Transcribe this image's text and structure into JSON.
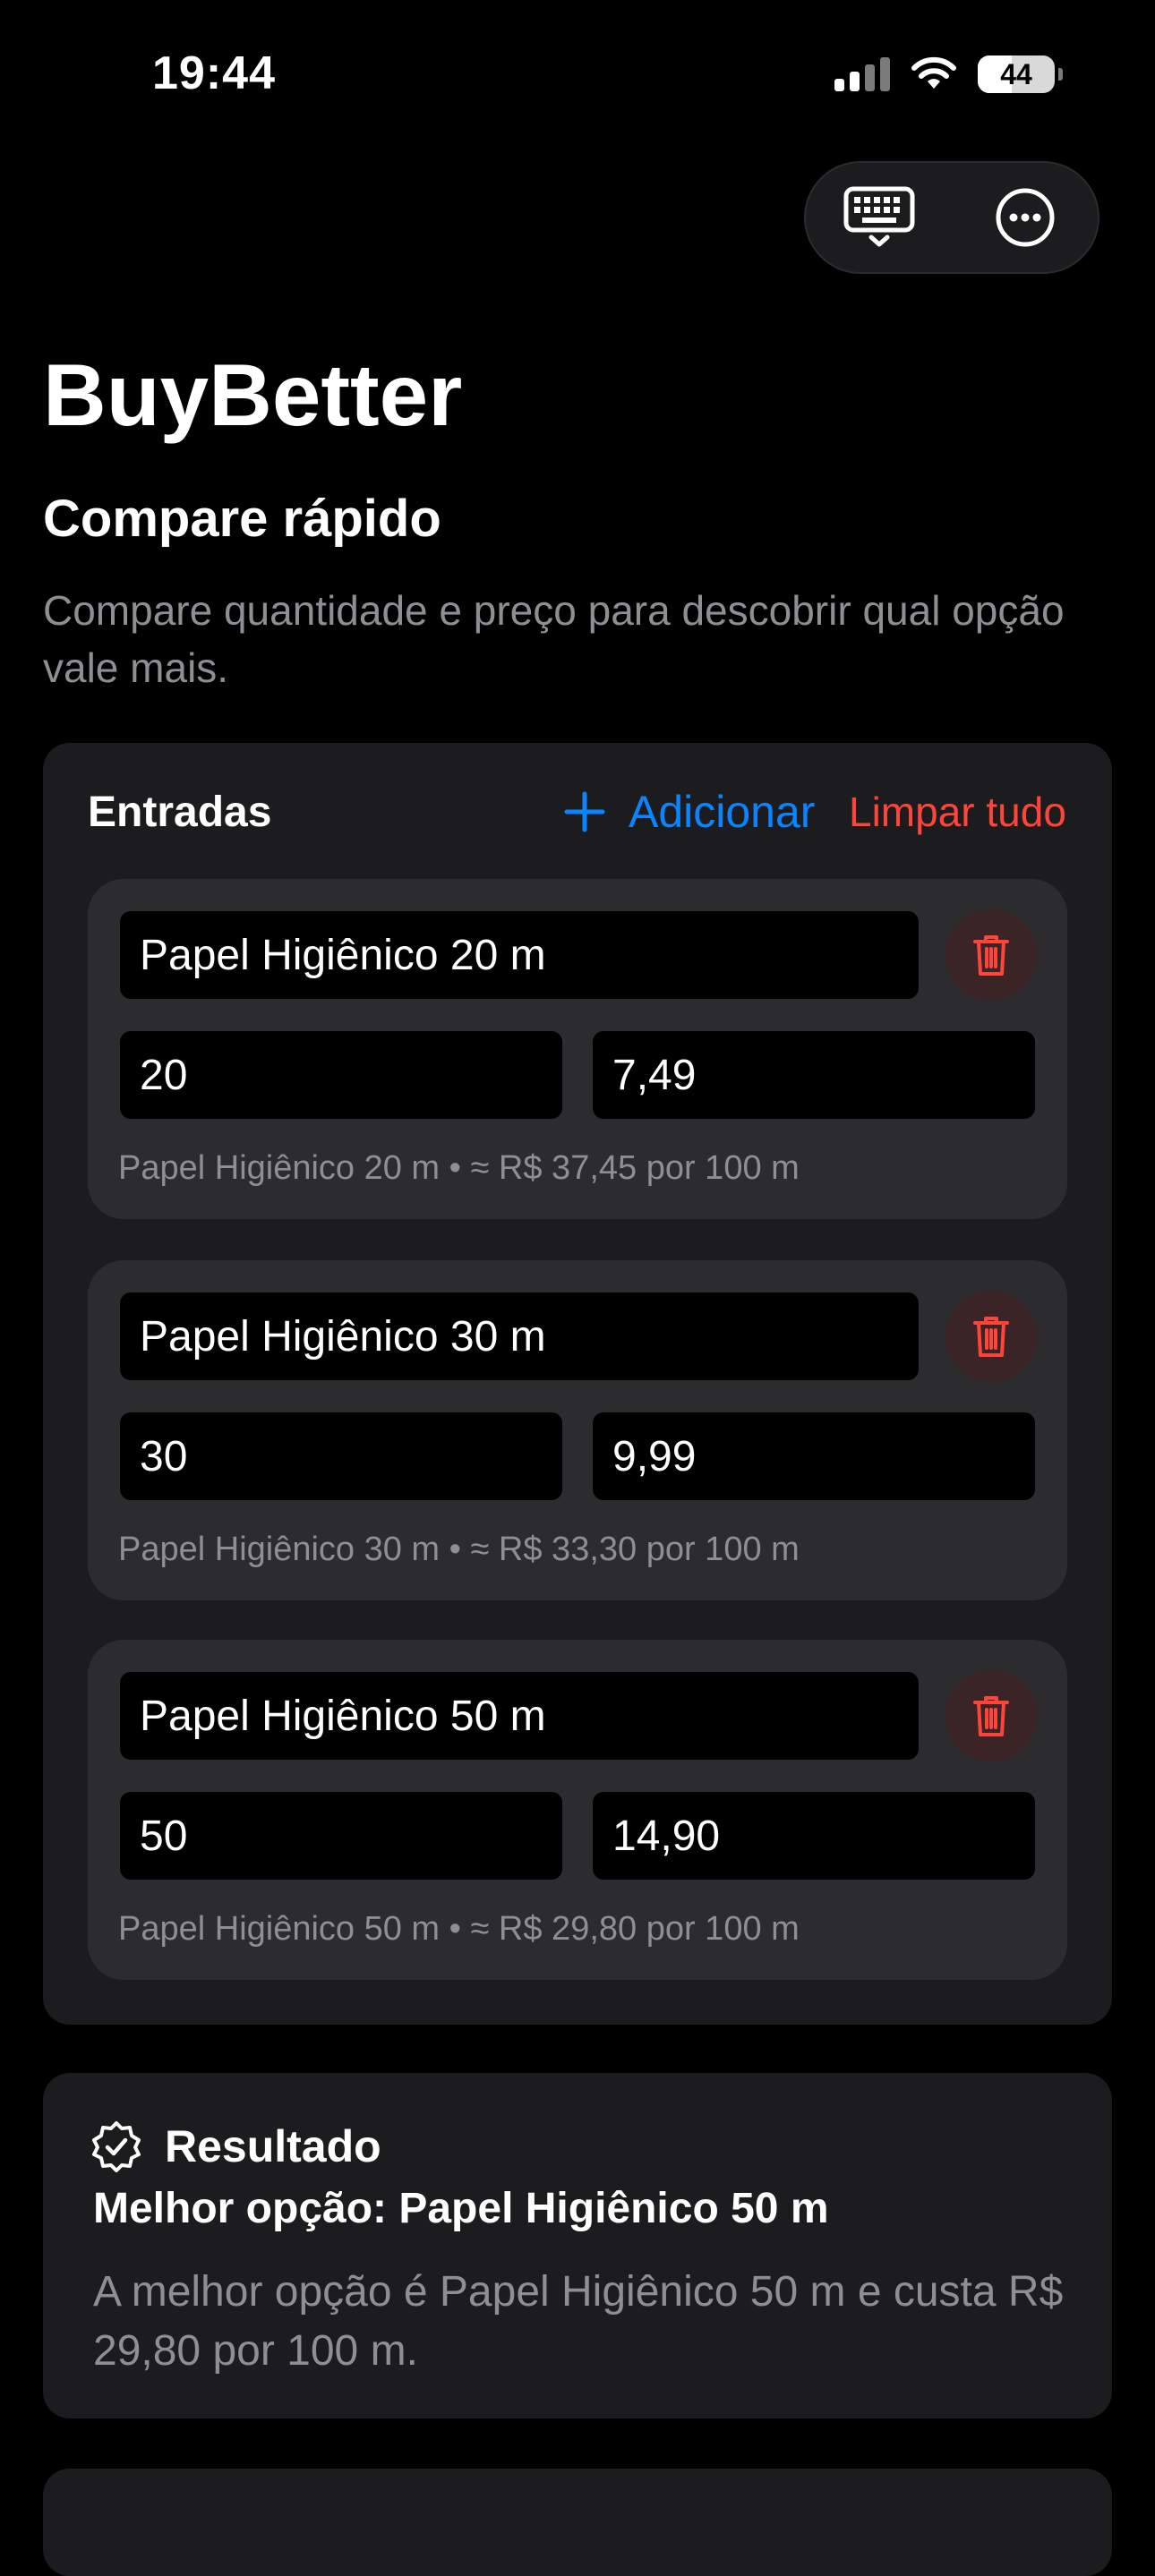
{
  "status_bar": {
    "time": "19:44",
    "battery": "44"
  },
  "app": {
    "title": "BuyBetter",
    "subtitle": "Compare rápido",
    "description": "Compare quantidade e preço para descobrir qual opção vale mais."
  },
  "entries_card": {
    "title": "Entradas",
    "add_label": "Adicionar",
    "clear_label": "Limpar tudo",
    "items": [
      {
        "name": "Papel Higiênico 20 m",
        "quantity": "20",
        "price": "7,49",
        "summary": "Papel Higiênico 20 m • ≈ R$ 37,45 por 100 m"
      },
      {
        "name": "Papel Higiênico 30 m",
        "quantity": "30",
        "price": "9,99",
        "summary": "Papel Higiênico 30 m • ≈ R$ 33,30 por 100 m"
      },
      {
        "name": "Papel Higiênico 50 m",
        "quantity": "50",
        "price": "14,90",
        "summary": "Papel Higiênico 50 m • ≈ R$ 29,80 por 100 m"
      }
    ]
  },
  "result": {
    "title": "Resultado",
    "best": "Melhor opção: Papel Higiênico 50 m",
    "text": "A melhor opção é Papel Higiênico 50 m e custa R$ 29,80 por 100 m."
  },
  "colors": {
    "accent": "#0a84ff",
    "destructive": "#ff453a",
    "card": "#1c1c1e",
    "entry": "#2c2c2e"
  },
  "icons": {
    "keyboard": "keyboard-icon",
    "more": "more-icon",
    "add": "plus-icon",
    "delete": "trash-icon",
    "result": "checkmark-seal-icon"
  }
}
